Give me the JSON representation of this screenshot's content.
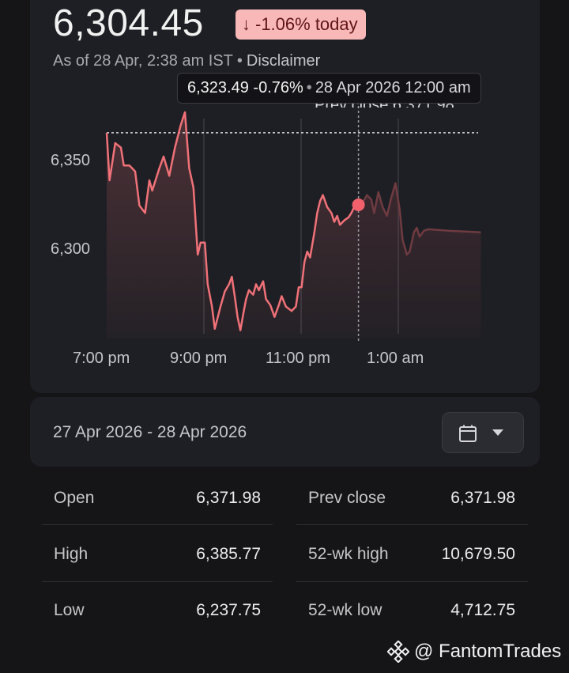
{
  "quote": {
    "price": "6,304.45",
    "change_text": "-1.06% today",
    "as_of": "As of 28 Apr, 2:38 am IST",
    "separator": "•",
    "disclaimer": "Disclaimer"
  },
  "tooltip": {
    "value": "6,323.49",
    "change": "-0.76%",
    "separator": "•",
    "datetime": "28 Apr 2026 12:00 am"
  },
  "chart_data": {
    "type": "line",
    "x_tick_labels": [
      "7:00 pm",
      "9:00 pm",
      "11:00 pm",
      "1:00 am"
    ],
    "y_tick_labels": [
      "6,350",
      "6,300"
    ],
    "ylim": [
      6237.75,
      6385.77
    ],
    "prev_close_label": "Prev close 6,371.98",
    "prev_close_value": 6371.98,
    "hover_point": {
      "time": "12:00 am",
      "value": 6323.49
    },
    "line_color": "#f07178",
    "future_color": "#6e3b41",
    "series": [
      {
        "t": 0,
        "v": 6371.98
      },
      {
        "t": 2,
        "v": 6340
      },
      {
        "t": 6,
        "v": 6365
      },
      {
        "t": 10,
        "v": 6362
      },
      {
        "t": 12,
        "v": 6350
      },
      {
        "t": 16,
        "v": 6350
      },
      {
        "t": 20,
        "v": 6346
      },
      {
        "t": 23,
        "v": 6323
      },
      {
        "t": 27,
        "v": 6318
      },
      {
        "t": 30,
        "v": 6340
      },
      {
        "t": 32,
        "v": 6333
      },
      {
        "t": 37,
        "v": 6348
      },
      {
        "t": 40,
        "v": 6356
      },
      {
        "t": 44,
        "v": 6343
      },
      {
        "t": 48,
        "v": 6362
      },
      {
        "t": 52,
        "v": 6377
      },
      {
        "t": 55,
        "v": 6385.77
      },
      {
        "t": 58,
        "v": 6348
      },
      {
        "t": 61,
        "v": 6335
      },
      {
        "t": 64,
        "v": 6290
      },
      {
        "t": 66,
        "v": 6298
      },
      {
        "t": 69,
        "v": 6298
      },
      {
        "t": 71,
        "v": 6270
      },
      {
        "t": 74,
        "v": 6255
      },
      {
        "t": 76,
        "v": 6240
      },
      {
        "t": 80,
        "v": 6255
      },
      {
        "t": 83,
        "v": 6265
      },
      {
        "t": 86,
        "v": 6270
      },
      {
        "t": 88,
        "v": 6275
      },
      {
        "t": 90,
        "v": 6262
      },
      {
        "t": 92,
        "v": 6248
      },
      {
        "t": 94,
        "v": 6239
      },
      {
        "t": 96,
        "v": 6250
      },
      {
        "t": 98,
        "v": 6260
      },
      {
        "t": 100,
        "v": 6266
      },
      {
        "t": 103,
        "v": 6263
      },
      {
        "t": 105,
        "v": 6270
      },
      {
        "t": 107,
        "v": 6266
      },
      {
        "t": 110,
        "v": 6272
      },
      {
        "t": 112,
        "v": 6260
      },
      {
        "t": 115,
        "v": 6256
      },
      {
        "t": 118,
        "v": 6248
      },
      {
        "t": 121,
        "v": 6256
      },
      {
        "t": 123,
        "v": 6262
      },
      {
        "t": 126,
        "v": 6255
      },
      {
        "t": 130,
        "v": 6252
      },
      {
        "t": 133,
        "v": 6255
      },
      {
        "t": 135,
        "v": 6268
      },
      {
        "t": 137,
        "v": 6268
      },
      {
        "t": 139,
        "v": 6285
      },
      {
        "t": 141,
        "v": 6292
      },
      {
        "t": 143,
        "v": 6288
      },
      {
        "t": 146,
        "v": 6305
      },
      {
        "t": 148,
        "v": 6318
      },
      {
        "t": 150,
        "v": 6326
      },
      {
        "t": 152,
        "v": 6330
      },
      {
        "t": 155,
        "v": 6322
      },
      {
        "t": 158,
        "v": 6318
      },
      {
        "t": 160,
        "v": 6312
      },
      {
        "t": 162,
        "v": 6316
      },
      {
        "t": 164,
        "v": 6310
      },
      {
        "t": 167,
        "v": 6313
      },
      {
        "t": 170,
        "v": 6315
      },
      {
        "t": 172,
        "v": 6318
      },
      {
        "t": 174,
        "v": 6322
      },
      {
        "t": 177,
        "v": 6323.49
      }
    ],
    "future_series": [
      {
        "t": 177,
        "v": 6323.49
      },
      {
        "t": 180,
        "v": 6325
      },
      {
        "t": 183,
        "v": 6330
      },
      {
        "t": 186,
        "v": 6327
      },
      {
        "t": 188,
        "v": 6318
      },
      {
        "t": 191,
        "v": 6332
      },
      {
        "t": 194,
        "v": 6322
      },
      {
        "t": 197,
        "v": 6316
      },
      {
        "t": 200,
        "v": 6328
      },
      {
        "t": 203,
        "v": 6338
      },
      {
        "t": 206,
        "v": 6320
      },
      {
        "t": 208,
        "v": 6300
      },
      {
        "t": 211,
        "v": 6290
      },
      {
        "t": 213,
        "v": 6292
      },
      {
        "t": 216,
        "v": 6305
      },
      {
        "t": 218,
        "v": 6308
      },
      {
        "t": 220,
        "v": 6302
      },
      {
        "t": 223,
        "v": 6306
      },
      {
        "t": 226,
        "v": 6307
      },
      {
        "t": 240,
        "v": 6306
      },
      {
        "t": 263,
        "v": 6305
      }
    ]
  },
  "range": {
    "text": "27 Apr 2026 - 28 Apr 2026",
    "calendar_icon": "calendar-icon",
    "dropdown_icon": "arrow-drop-down-icon"
  },
  "stats": {
    "open_label": "Open",
    "open_value": "6,371.98",
    "high_label": "High",
    "high_value": "6,385.77",
    "low_label": "Low",
    "low_value": "6,237.75",
    "prev_close_label": "Prev close",
    "prev_close_value": "6,371.98",
    "wk52_high_label": "52-wk high",
    "wk52_high_value": "10,679.50",
    "wk52_low_label": "52-wk low",
    "wk52_low_value": "4,712.75"
  },
  "watermark": {
    "text": "@ FantomTrades",
    "icon": "binance-logo-icon"
  },
  "colors": {
    "background": "#151518",
    "card": "#1e1f24",
    "badge_bg": "#f9b8b8",
    "badge_text": "#601414",
    "line": "#f07178"
  }
}
